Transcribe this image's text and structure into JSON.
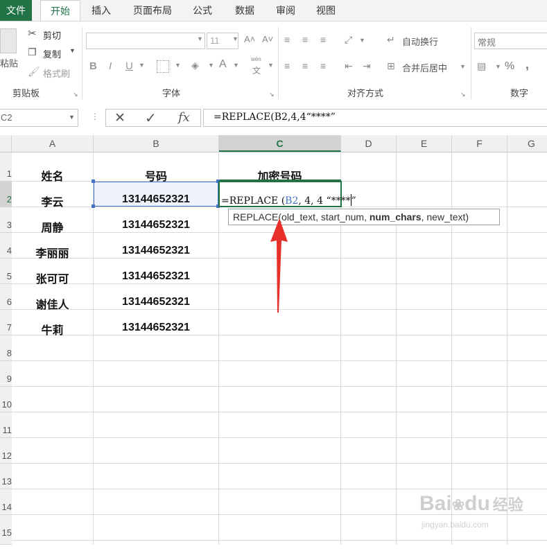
{
  "tabs": [
    "文件",
    "开始",
    "插入",
    "页面布局",
    "公式",
    "数据",
    "审阅",
    "视图"
  ],
  "clipboard": {
    "paste": "粘贴",
    "cut": "剪切",
    "copy": "复制",
    "format_painter": "格式刷",
    "label": "剪贴板"
  },
  "font": {
    "size": "11",
    "bold": "B",
    "italic": "I",
    "underline": "U",
    "font_color": "A",
    "phonetic_top": "wén",
    "phonetic_bottom": "文",
    "label": "字体"
  },
  "alignment": {
    "wrap_text": "自动换行",
    "merge_center": "合并后居中",
    "label": "对齐方式"
  },
  "number": {
    "format": "常规",
    "percent": "%",
    "comma": ",",
    "label": "数字"
  },
  "formula_bar": {
    "name_box": "C2",
    "cancel": "✕",
    "enter": "✓",
    "fx": "fx",
    "formula": "=REPLACE(B2,4,4“****”"
  },
  "columns": [
    "A",
    "B",
    "C",
    "D",
    "E",
    "F",
    "G"
  ],
  "rows": [
    "1",
    "2",
    "3",
    "4",
    "5",
    "6",
    "7",
    "8",
    "9",
    "10",
    "11",
    "12",
    "13",
    "14",
    "15"
  ],
  "headers": {
    "name": "姓名",
    "number": "号码",
    "encrypted": "加密号码"
  },
  "people": [
    {
      "name": "李云",
      "number": "13144652321"
    },
    {
      "name": "周静",
      "number": "13144652321"
    },
    {
      "name": "李丽丽",
      "number": "13144652321"
    },
    {
      "name": "张可可",
      "number": "13144652321"
    },
    {
      "name": "谢佳人",
      "number": "13144652321"
    },
    {
      "name": "牛莉",
      "number": "13144652321"
    }
  ],
  "editing": {
    "prefix": "=REPLACE (",
    "ref": "B2",
    "args": ", 4, 4 “****",
    "close": "”"
  },
  "tooltip": {
    "fn": "REPLACE(",
    "arg1": "old_text, start_num, ",
    "arg_active": "num_chars",
    "arg_rest": ", new_text)"
  },
  "watermark": {
    "brand": "Bai",
    "brand2": "du",
    "product": "经验",
    "url": "jingyan.baidu.com"
  },
  "colors": {
    "excel_green": "#217346",
    "ref_blue": "#4472c4",
    "arrow_red": "#e8302a"
  }
}
